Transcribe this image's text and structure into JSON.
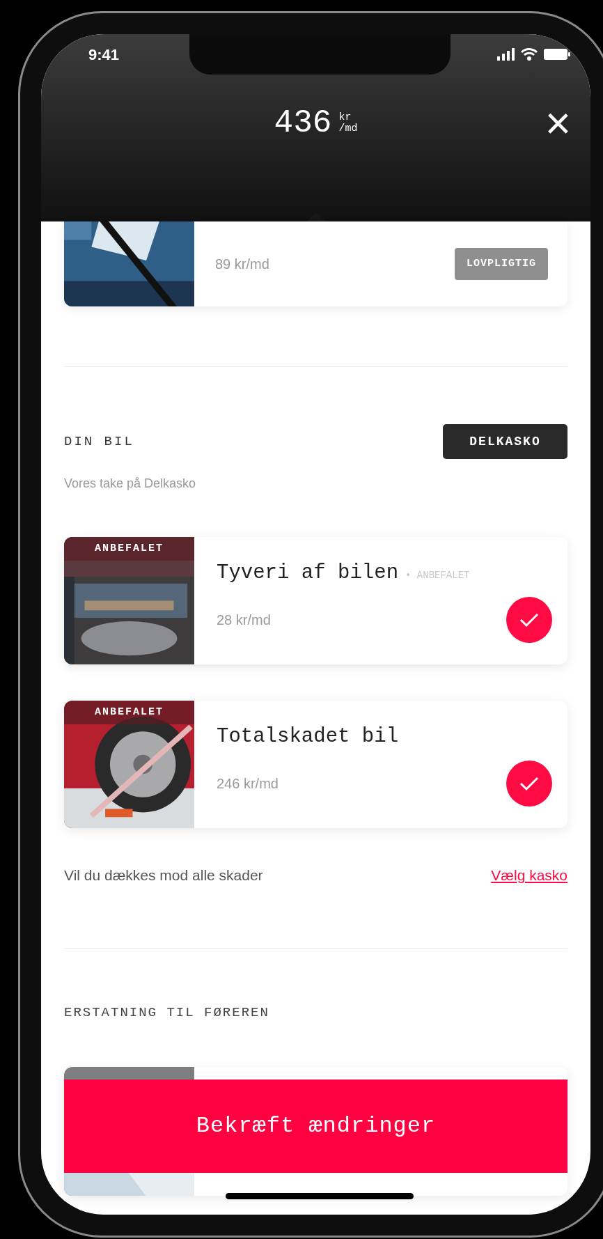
{
  "status_bar": {
    "time": "9:41"
  },
  "header": {
    "price": "436",
    "unit_top": "kr",
    "unit_bottom": "/md",
    "close": "×"
  },
  "top_card": {
    "price": "89 kr/md",
    "badge": "LOVPLIGTIG"
  },
  "section": {
    "title": "DIN BIL",
    "tag": "DELKASKO",
    "subtitle": "Vores take på Delkasko",
    "cards": [
      {
        "badge": "ANBEFALET",
        "title": "Tyveri af bilen",
        "note": "• ANBEFALET",
        "price": "28 kr/md",
        "selected": true
      },
      {
        "badge": "ANBEFALET",
        "title": "Totalskadet bil",
        "price": "246 kr/md",
        "selected": true
      }
    ],
    "footer_text": "Vil du dækkes mod alle skader",
    "footer_link": "Vælg kasko"
  },
  "section2": {
    "title": "ERSTATNING TIL FØREREN"
  },
  "confirm_button": "Bekræft ændringer"
}
